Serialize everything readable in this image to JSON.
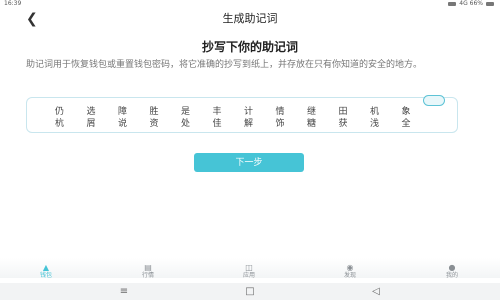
{
  "status_bar": {
    "time": "16:39",
    "right_text": "4G 66%"
  },
  "nav": {
    "title": "生成助记词"
  },
  "heading": "抄写下你的助记词",
  "description": "助记词用于恢复钱包或重置钱包密码，将它准确的抄写到纸上，并存放在只有你知道的安全的地方。",
  "mnemonic": {
    "row1": [
      "仍",
      "选",
      "障",
      "胜",
      "是",
      "丰",
      "计",
      "情",
      "继",
      "田",
      "机",
      "象"
    ],
    "row2": [
      "杭",
      "屑",
      "说",
      "资",
      "处",
      "佳",
      "解",
      "饰",
      "糖",
      "获",
      "浅",
      "全"
    ]
  },
  "next_button": "下一步",
  "tabs": [
    {
      "label": "钱包",
      "icon": "wallet-icon"
    },
    {
      "label": "行情",
      "icon": "chart-icon"
    },
    {
      "label": "应用",
      "icon": "apps-icon"
    },
    {
      "label": "发现",
      "icon": "discover-icon"
    },
    {
      "label": "我的",
      "icon": "profile-icon"
    }
  ],
  "accent_color": "#46c4d6"
}
